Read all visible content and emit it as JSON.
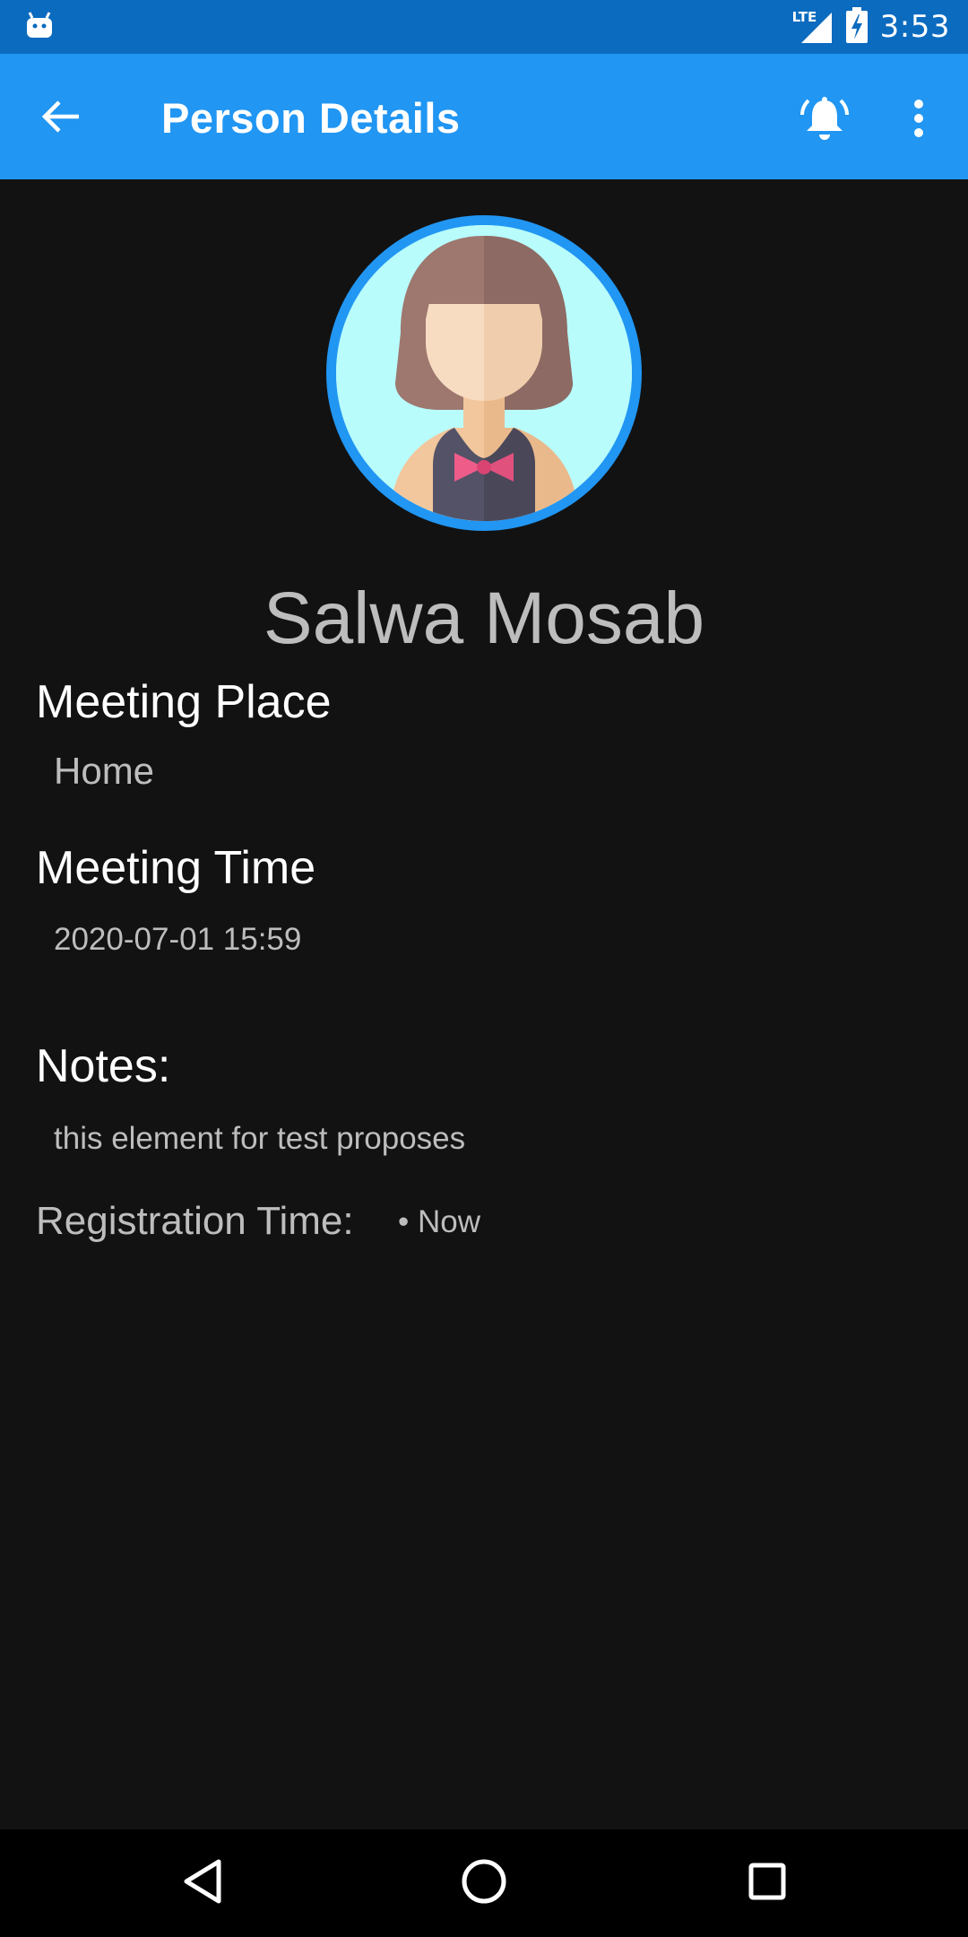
{
  "status_bar": {
    "network_label": "LTE",
    "time": "3:53",
    "icons": [
      "android-icon",
      "signal-icon",
      "battery-charging-icon"
    ]
  },
  "app_bar": {
    "title": "Person Details",
    "icons": [
      "back-arrow-icon",
      "bell-alarm-icon",
      "more-vert-icon"
    ]
  },
  "person": {
    "name": "Salwa Mosab",
    "avatar_icon": "female-avatar-icon"
  },
  "details": {
    "meeting_place_label": "Meeting Place",
    "meeting_place_value": "Home",
    "meeting_time_label": "Meeting Time",
    "meeting_time_value": "2020-07-01 15:59",
    "notes_label": "Notes:",
    "notes_value": "this element for test proposes",
    "registration_label": "Registration Time:",
    "registration_value": "• Now"
  },
  "nav_bar": {
    "icons": [
      "nav-back-icon",
      "nav-home-icon",
      "nav-recents-icon"
    ]
  },
  "colors": {
    "status_bar": "#0b6bbf",
    "app_bar": "#2196f3",
    "background": "#121212",
    "avatar_ring": "#2196f3",
    "avatar_bg": "#b8fcfc",
    "muted_text": "#bdbdbd"
  }
}
